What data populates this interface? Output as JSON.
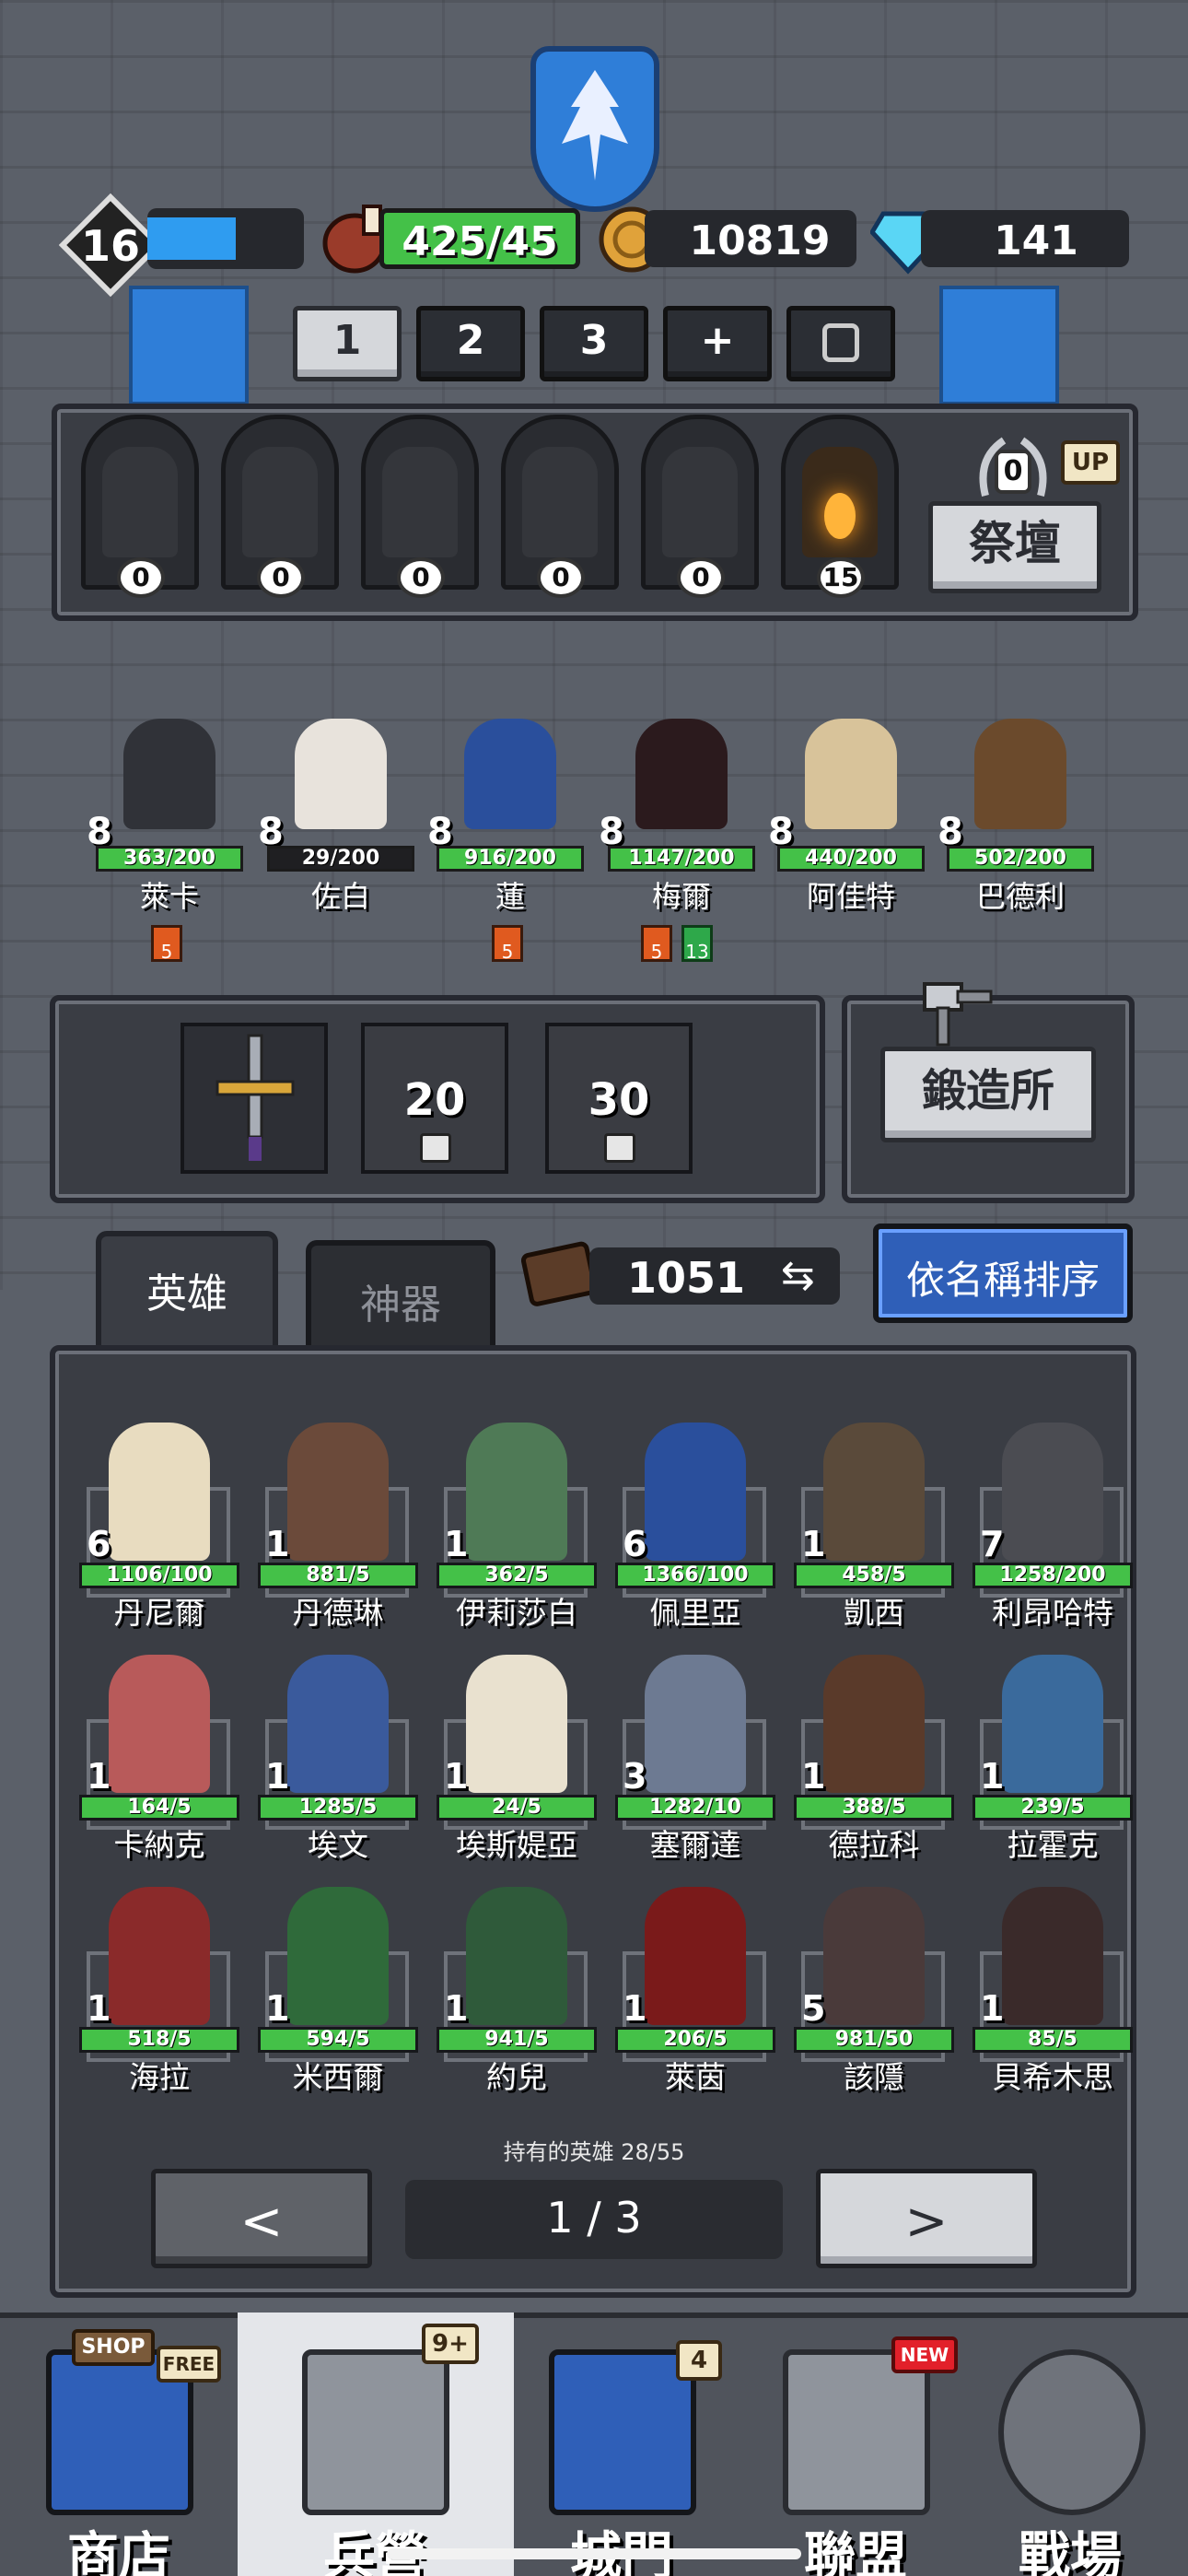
{
  "header": {
    "level": "16",
    "meat": "425/45",
    "gold": "10819",
    "gems": "141"
  },
  "team_tabs": [
    "1",
    "2",
    "3",
    "+"
  ],
  "shrines": [
    "0",
    "0",
    "0",
    "0",
    "0",
    "15"
  ],
  "altar": {
    "count": "0",
    "up_badge": "UP",
    "button": "祭壇"
  },
  "party": [
    {
      "level": "8",
      "xp": "363/200",
      "name": "萊卡",
      "tags": [
        "5"
      ]
    },
    {
      "level": "8",
      "xp": "29/200",
      "name": "佐白",
      "tags": []
    },
    {
      "level": "8",
      "xp": "916/200",
      "name": "蓮",
      "tags": [
        "5"
      ]
    },
    {
      "level": "8",
      "xp": "1147/200",
      "name": "梅爾",
      "tags": [
        "5",
        "13"
      ]
    },
    {
      "level": "8",
      "xp": "440/200",
      "name": "阿佳特",
      "tags": []
    },
    {
      "level": "8",
      "xp": "502/200",
      "name": "巴德利",
      "tags": []
    }
  ],
  "equipment": {
    "slot2_lock": "20",
    "slot3_lock": "30",
    "forge_button": "鍛造所"
  },
  "tabs": {
    "heroes": "英雄",
    "artifacts": "神器",
    "book_count": "1051",
    "sort_button": "依名稱排序"
  },
  "heroes": [
    {
      "level": "6",
      "xp": "1106/100",
      "name": "丹尼爾"
    },
    {
      "level": "1",
      "xp": "881/5",
      "name": "丹德琳"
    },
    {
      "level": "1",
      "xp": "362/5",
      "name": "伊莉莎白"
    },
    {
      "level": "6",
      "xp": "1366/100",
      "name": "佩里亞"
    },
    {
      "level": "1",
      "xp": "458/5",
      "name": "凱西"
    },
    {
      "level": "7",
      "xp": "1258/200",
      "name": "利昂哈特"
    },
    {
      "level": "1",
      "xp": "164/5",
      "name": "卡納克"
    },
    {
      "level": "1",
      "xp": "1285/5",
      "name": "埃文"
    },
    {
      "level": "1",
      "xp": "24/5",
      "name": "埃斯媞亞"
    },
    {
      "level": "3",
      "xp": "1282/10",
      "name": "塞爾達"
    },
    {
      "level": "1",
      "xp": "388/5",
      "name": "德拉科"
    },
    {
      "level": "1",
      "xp": "239/5",
      "name": "拉霍克"
    },
    {
      "level": "1",
      "xp": "518/5",
      "name": "海拉"
    },
    {
      "level": "1",
      "xp": "594/5",
      "name": "米西爾"
    },
    {
      "level": "1",
      "xp": "941/5",
      "name": "約兒"
    },
    {
      "level": "1",
      "xp": "206/5",
      "name": "萊茵"
    },
    {
      "level": "5",
      "xp": "981/50",
      "name": "該隱"
    },
    {
      "level": "1",
      "xp": "85/5",
      "name": "貝希木思"
    }
  ],
  "owned_text": "持有的英雄 28/55",
  "pager": {
    "prev": "<",
    "page": "1 / 3",
    "next": ">"
  },
  "bottom_nav": [
    {
      "label": "商店",
      "badge": "FREE",
      "sign": "SHOP"
    },
    {
      "label": "兵營",
      "badge": "9+"
    },
    {
      "label": "城門",
      "badge": "4"
    },
    {
      "label": "聯盟",
      "badge": "NEW"
    },
    {
      "label": "戰場",
      "badge": ""
    }
  ],
  "colors": {
    "xp_bar": "#2f9cf0",
    "hp_green": "#44c148",
    "sort_button": "#2f5fb8",
    "panel": "#3a3d44"
  }
}
